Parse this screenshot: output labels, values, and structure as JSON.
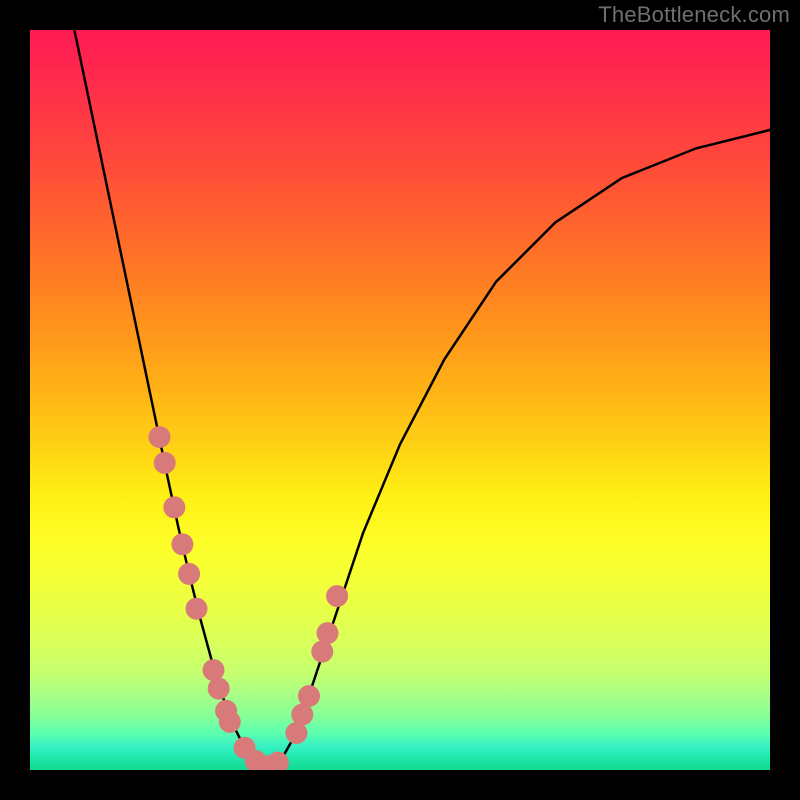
{
  "watermark": "TheBottleneck.com",
  "colors": {
    "background": "#000000",
    "curve": "#000000",
    "marker_fill": "#d97a7a",
    "marker_stroke": "#c96a6a",
    "gradient_top": "#ff1a54",
    "gradient_bottom": "#13db8f"
  },
  "chart_data": {
    "type": "line",
    "title": "",
    "xlabel": "",
    "ylabel": "",
    "xlim": [
      0,
      1
    ],
    "ylim": [
      0,
      1
    ],
    "series": [
      {
        "name": "curve",
        "x": [
          0.06,
          0.085,
          0.11,
          0.135,
          0.16,
          0.185,
          0.2,
          0.215,
          0.23,
          0.245,
          0.26,
          0.275,
          0.29,
          0.305,
          0.32,
          0.34,
          0.36,
          0.38,
          0.41,
          0.45,
          0.5,
          0.56,
          0.63,
          0.71,
          0.8,
          0.9,
          1.0
        ],
        "y": [
          1.0,
          0.88,
          0.76,
          0.64,
          0.52,
          0.4,
          0.33,
          0.265,
          0.205,
          0.15,
          0.1,
          0.06,
          0.03,
          0.012,
          0.005,
          0.015,
          0.05,
          0.11,
          0.2,
          0.32,
          0.44,
          0.555,
          0.66,
          0.74,
          0.8,
          0.84,
          0.865
        ]
      }
    ],
    "markers": {
      "name": "highlighted-points",
      "x": [
        0.175,
        0.182,
        0.195,
        0.206,
        0.215,
        0.225,
        0.248,
        0.255,
        0.265,
        0.27,
        0.29,
        0.305,
        0.32,
        0.335,
        0.36,
        0.368,
        0.377,
        0.395,
        0.402,
        0.415
      ],
      "y": [
        0.45,
        0.415,
        0.355,
        0.305,
        0.265,
        0.218,
        0.135,
        0.11,
        0.08,
        0.065,
        0.03,
        0.012,
        0.005,
        0.01,
        0.05,
        0.075,
        0.1,
        0.16,
        0.185,
        0.235
      ]
    }
  }
}
